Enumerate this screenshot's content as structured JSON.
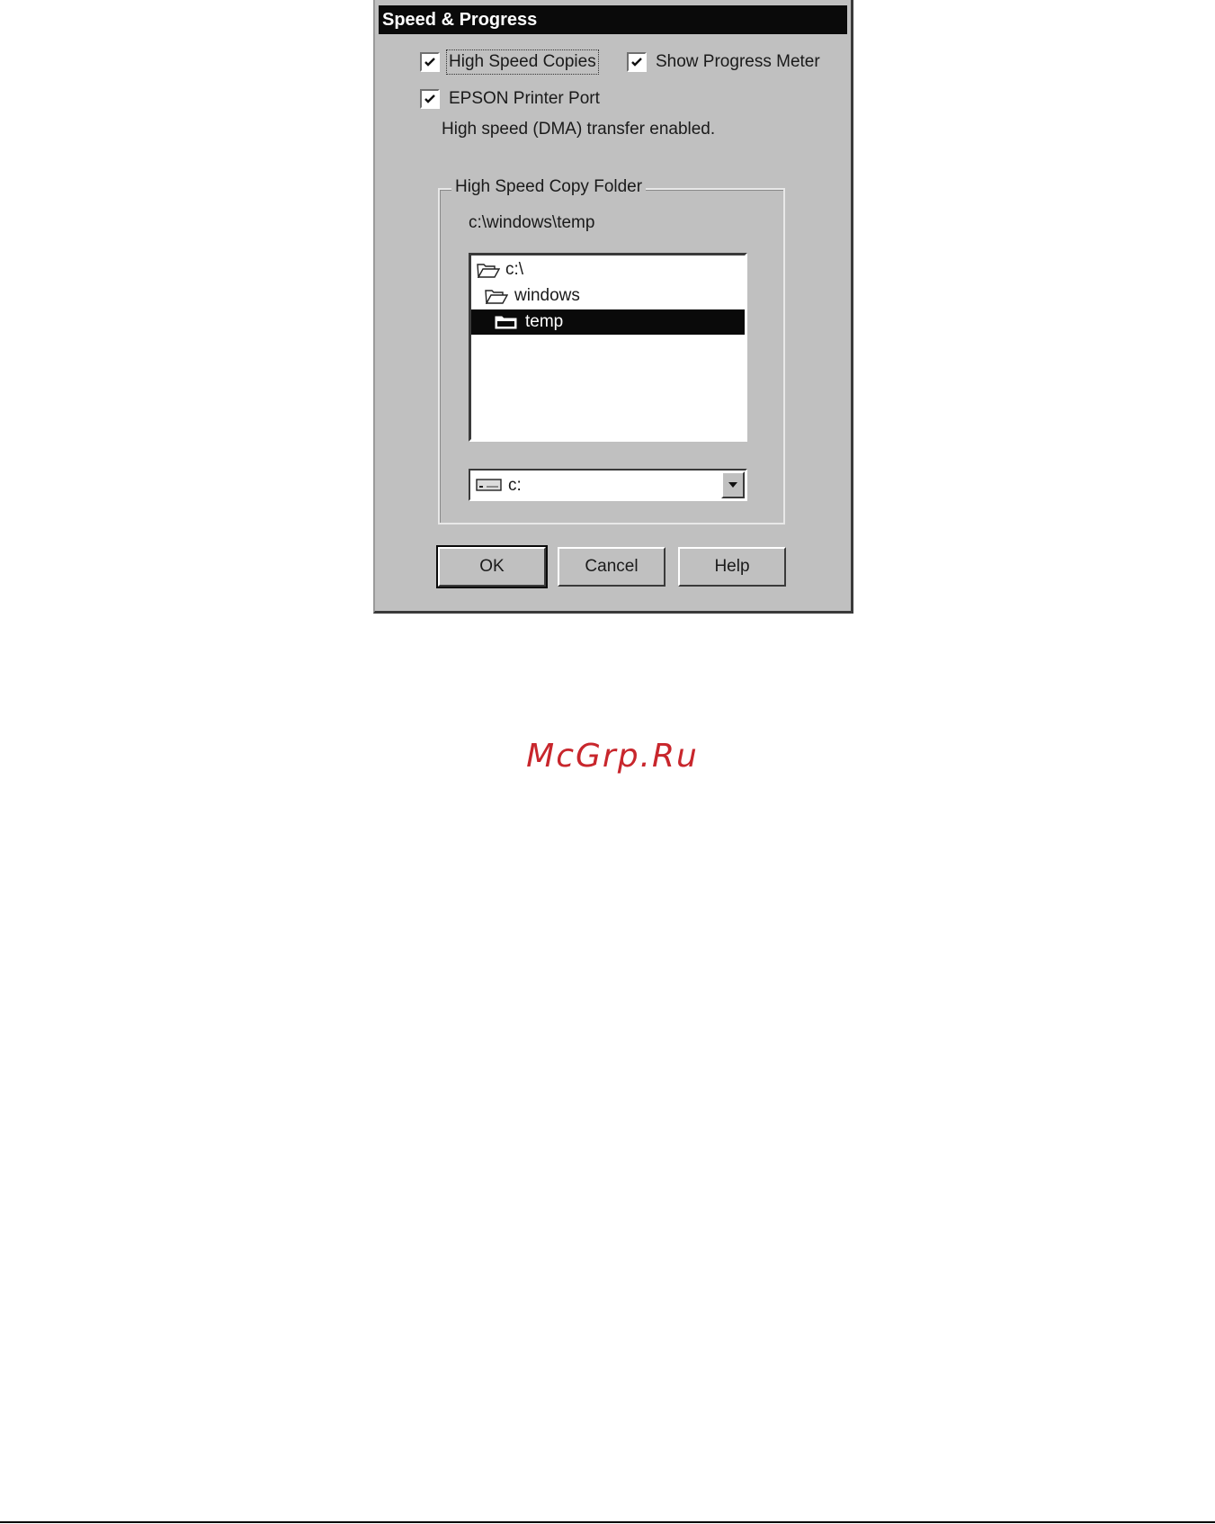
{
  "dialog": {
    "title": "Speed & Progress",
    "high_speed_copies": {
      "label": "High Speed Copies",
      "checked": true
    },
    "show_progress_meter": {
      "label": "Show Progress Meter",
      "checked": true
    },
    "epson_printer_port": {
      "label": "EPSON Printer Port",
      "checked": true
    },
    "status_text": "High speed (DMA) transfer enabled.",
    "group": {
      "title": "High Speed Copy Folder",
      "current_path": "c:\\windows\\temp",
      "folders": [
        {
          "name": "c:\\",
          "selected": false
        },
        {
          "name": "windows",
          "selected": false
        },
        {
          "name": "temp",
          "selected": true
        }
      ],
      "drive": {
        "value": "c:"
      }
    },
    "buttons": {
      "ok": "OK",
      "cancel": "Cancel",
      "help": "Help"
    }
  },
  "watermark": "McGrp.Ru"
}
